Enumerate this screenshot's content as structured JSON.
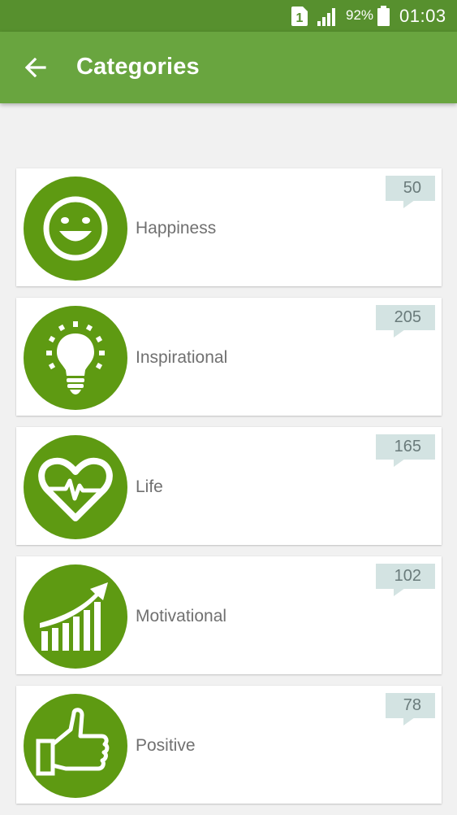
{
  "status_bar": {
    "sim_label": "1",
    "battery_percent": "92%",
    "time": "01:03"
  },
  "app_bar": {
    "title": "Categories",
    "back_icon": "arrow-left-icon"
  },
  "theme": {
    "status_bar_color": "#57902e",
    "app_bar_color": "#69a53f",
    "icon_circle_color": "#5e9a12",
    "badge_color": "#d3e3e2"
  },
  "categories": [
    {
      "label": "Happiness",
      "count": "50",
      "icon": "smiley-face-icon"
    },
    {
      "label": "Inspirational",
      "count": "205",
      "icon": "lightbulb-icon"
    },
    {
      "label": "Life",
      "count": "165",
      "icon": "heartbeat-heart-icon"
    },
    {
      "label": "Motivational",
      "count": "102",
      "icon": "growth-chart-arrow-icon"
    },
    {
      "label": "Positive",
      "count": "78",
      "icon": "thumbs-up-icon"
    }
  ]
}
